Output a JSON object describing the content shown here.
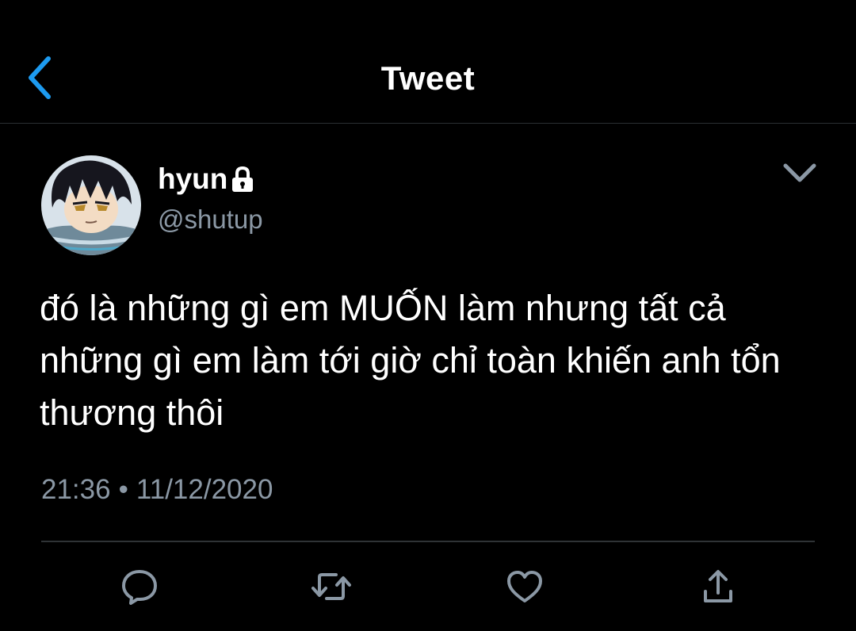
{
  "header": {
    "back_icon": "chevron-left-icon",
    "title": "Tweet"
  },
  "tweet": {
    "author": {
      "display_name": "hyun",
      "handle": "@shutup",
      "protected_icon": "lock-icon",
      "avatar": "avatar-image"
    },
    "menu_icon": "chevron-down-icon",
    "text": "đó là những gì em MUỐN làm nhưng tất cả những gì em làm tới giờ chỉ toàn khiến anh tổn thương thôi",
    "time": "21:36",
    "separator": "•",
    "date": "11/12/2020"
  },
  "actions": [
    {
      "name": "reply",
      "icon": "reply-icon"
    },
    {
      "name": "retweet",
      "icon": "retweet-icon"
    },
    {
      "name": "like",
      "icon": "heart-icon"
    },
    {
      "name": "share",
      "icon": "share-icon"
    }
  ],
  "colors": {
    "background": "#000000",
    "text_primary": "#ffffff",
    "text_secondary": "#8b98a5",
    "accent": "#1d9bf0",
    "divider": "#2f3336"
  }
}
